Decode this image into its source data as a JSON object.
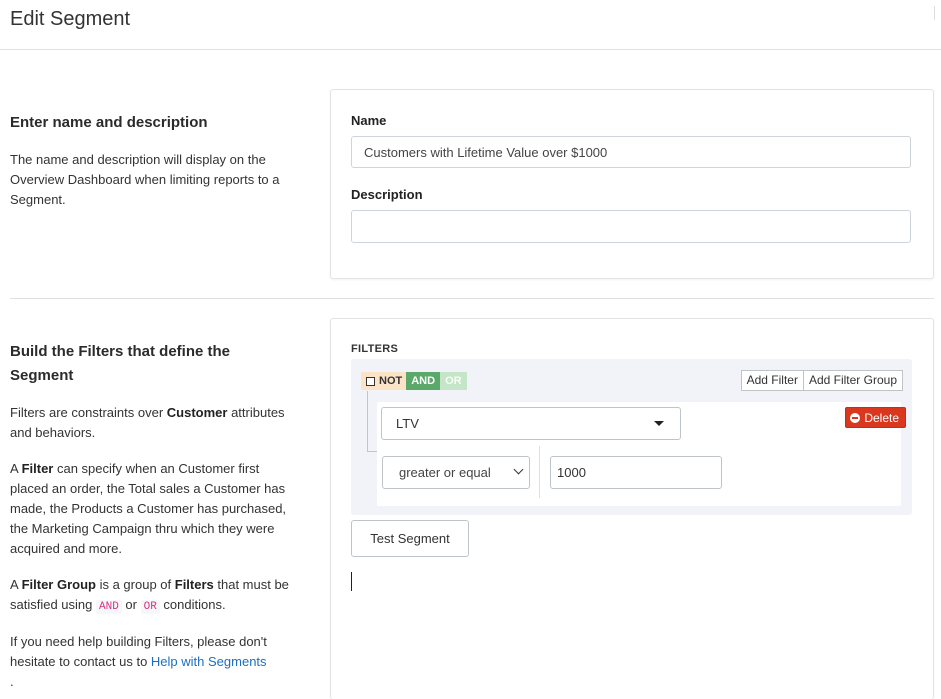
{
  "page": {
    "title": "Edit Segment"
  },
  "name_section": {
    "heading": "Enter name and description",
    "description": "The name and description will display on the Overview Dashboard when limiting reports to a Segment.",
    "name_label": "Name",
    "name_value": "Customers with Lifetime Value over $1000",
    "description_label": "Description",
    "description_value": ""
  },
  "filters_section": {
    "heading": "Build the Filters that define the Segment",
    "p1": {
      "a": "Filters are constraints over ",
      "b": "Customer",
      "c": " attributes and behaviors."
    },
    "p2": {
      "a": "A ",
      "b": "Filter",
      "c": " can specify when an Customer first placed an order, the Total sales a Customer has made, the Products a Customer has purchased, the Marketing Campaign thru which they were acquired and more."
    },
    "p3": {
      "a": "A ",
      "b": "Filter Group",
      "c": " is a group of ",
      "d": "Filters",
      "e": " that must be satisfied using ",
      "and_code": "AND",
      "f": " or ",
      "or_code": "OR",
      "g": " conditions."
    },
    "p4": {
      "a": "If you need help building Filters, please don't hesitate to contact us to ",
      "link": "Help with Segments",
      "b": "."
    }
  },
  "builder": {
    "label": "FILTERS",
    "not_label": "NOT",
    "and_label": "AND",
    "or_label": "OR",
    "add_filter": "Add Filter",
    "add_filter_group": "Add Filter Group",
    "rule": {
      "field": "LTV",
      "operator": "greater or equal",
      "value": "1000",
      "delete_label": "Delete"
    },
    "test_button": "Test Segment"
  },
  "colors": {
    "not_bg": "#fbe3c8",
    "and_bg": "#5ba96a",
    "or_bg": "#c5e5c8",
    "delete_bg": "#d9381e",
    "link": "#1a6fc4",
    "group_bg": "#f1f3f8"
  },
  "icons": [
    "minus-circle-icon",
    "caret-down-icon",
    "chevron-down-icon"
  ]
}
